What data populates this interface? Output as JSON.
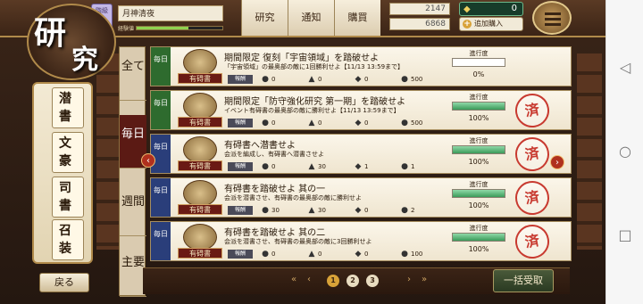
{
  "title": {
    "char1": "研",
    "char2": "究"
  },
  "player": {
    "level_label": "階級",
    "level": "11",
    "name": "月神清夜",
    "exp_label": "経験値",
    "exp_fraction": 0.6
  },
  "nav": {
    "research": "研究",
    "notice": "通知",
    "purchase": "購買"
  },
  "resources": {
    "ink": "2147",
    "rice": "6868"
  },
  "coins": {
    "value": "0",
    "buy_label": "追加購入"
  },
  "side": [
    {
      "c1": "潜",
      "c2": "書"
    },
    {
      "c1": "文",
      "c2": "豪"
    },
    {
      "c1": "司",
      "c2": "書"
    },
    {
      "c1": "召",
      "c2": "装"
    }
  ],
  "back_label": "戻る",
  "tabs": [
    {
      "label": "全て"
    },
    {
      "label": "毎日"
    },
    {
      "label": "週間"
    },
    {
      "label": "主要"
    }
  ],
  "missions": [
    {
      "freq": "毎日",
      "freq_color": "#2e6b2e",
      "book": "有碍書",
      "title": "期間限定 復刻「宇宙領域」を踏破せよ",
      "desc": "「宇宙領域」の最奥部の敵に1回勝利せよ【11/13 13:59まで】",
      "reward_label": "報酬",
      "rewards": [
        "0",
        "0",
        "0",
        "500"
      ],
      "progress_label": "進行度",
      "progress": 0,
      "progress_text": "0%",
      "completed": false
    },
    {
      "freq": "毎日",
      "freq_color": "#2e6b2e",
      "book": "有碍書",
      "title": "期間限定「防守強化研究 第一期」を踏破せよ",
      "desc": "イベント有碍書の最奥部の敵に勝利せよ【11/13 13:59まで】",
      "reward_label": "報酬",
      "rewards": [
        "0",
        "0",
        "0",
        "500"
      ],
      "progress_label": "進行度",
      "progress": 1,
      "progress_text": "100%",
      "completed": true
    },
    {
      "freq": "毎日",
      "freq_color": "#2a3e7a",
      "book": "有碍書",
      "title": "有碍書へ潜書せよ",
      "desc": "会派を編成し、有碍書へ潜書させよ",
      "reward_label": "報酬",
      "rewards": [
        "0",
        "30",
        "1",
        "1"
      ],
      "progress_label": "進行度",
      "progress": 1,
      "progress_text": "100%",
      "completed": true
    },
    {
      "freq": "毎日",
      "freq_color": "#2a3e7a",
      "book": "有碍書",
      "title": "有碍書を踏破せよ 其の一",
      "desc": "会派を潜書させ、有碍書の最奥部の敵に勝利せよ",
      "reward_label": "報酬",
      "rewards": [
        "30",
        "30",
        "0",
        "2"
      ],
      "progress_label": "進行度",
      "progress": 1,
      "progress_text": "100%",
      "completed": true
    },
    {
      "freq": "毎日",
      "freq_color": "#2a3e7a",
      "book": "有碍書",
      "title": "有碍書を踏破せよ 其の二",
      "desc": "会派を潜書させ、有碍書の最奥部の敵に3回勝利せよ",
      "reward_label": "報酬",
      "rewards": [
        "0",
        "0",
        "0",
        "100"
      ],
      "progress_label": "進行度",
      "progress": 1,
      "progress_text": "100%",
      "completed": true
    }
  ],
  "stamp_char": "済",
  "pager": {
    "pages": [
      "1",
      "2",
      "3"
    ],
    "current": "1"
  },
  "collect_all": "一括受取",
  "icons": {
    "ink": "ink-bottle-icon",
    "rice": "onigiri-icon",
    "coin": "coin-icon",
    "menu": "hamburger-icon"
  }
}
